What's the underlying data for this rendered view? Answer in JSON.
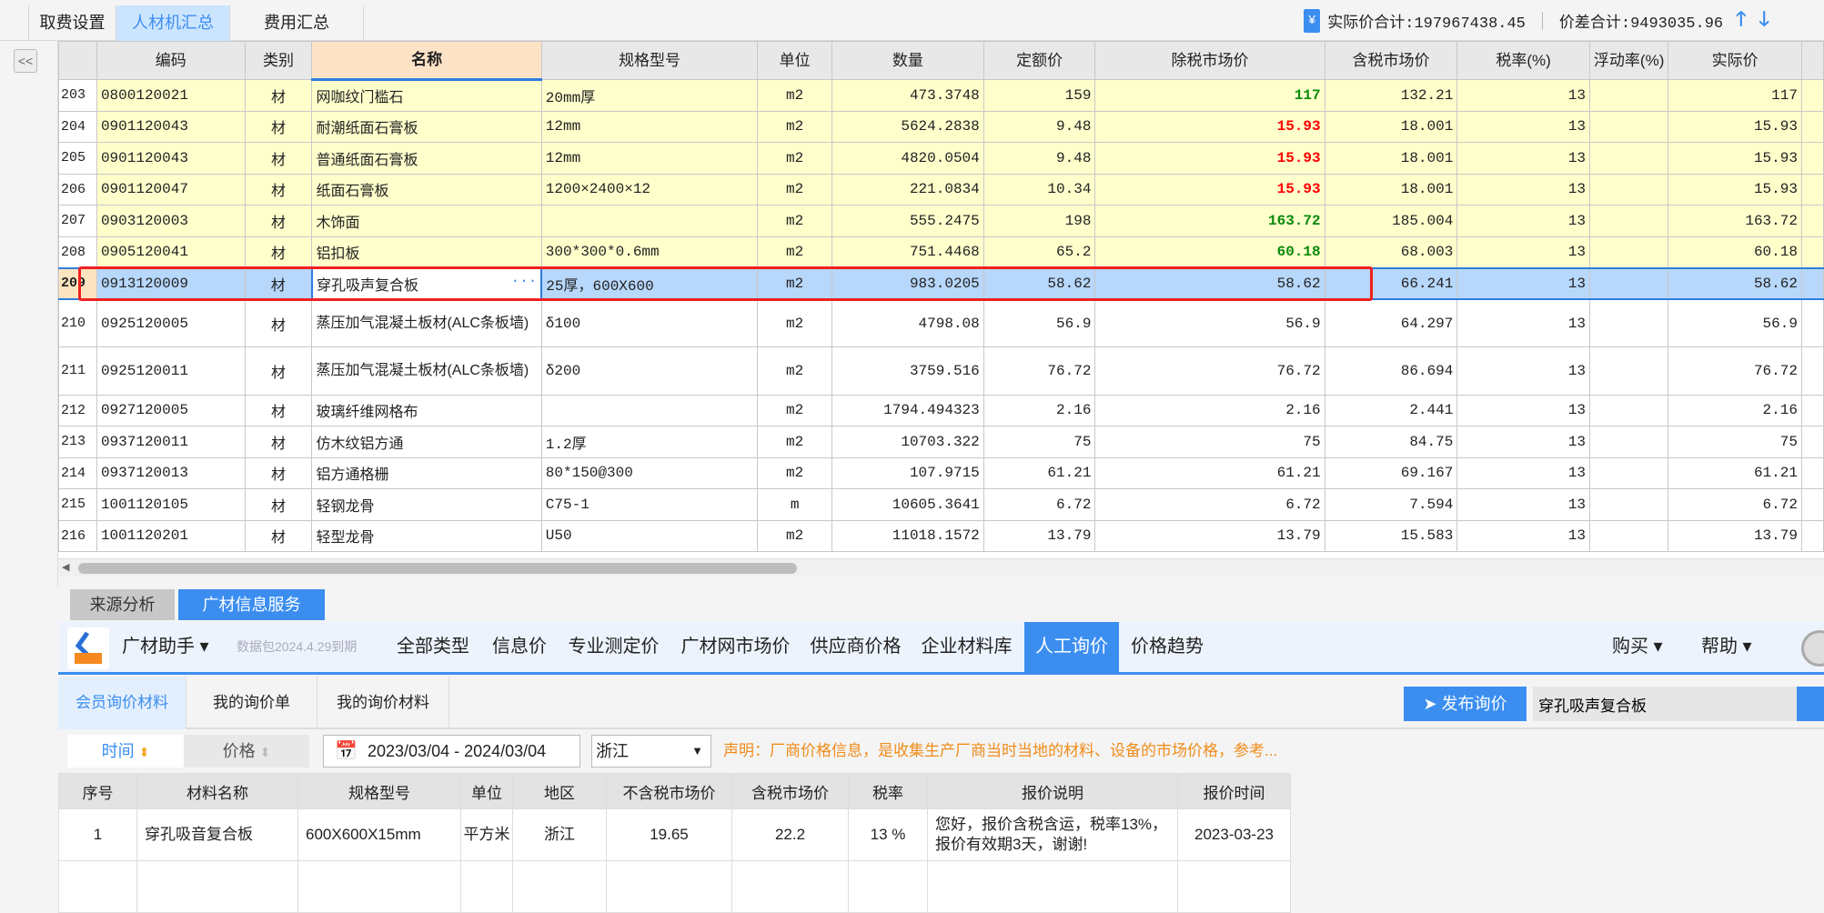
{
  "top_tabs": [
    {
      "label": "取费设置"
    },
    {
      "label": "人材机汇总",
      "active": true
    },
    {
      "label": "费用汇总"
    }
  ],
  "summary": {
    "actual_total": "实际价合计:197967438.45",
    "diff_total": "价差合计:9493035.96",
    "yen_icon": "¥"
  },
  "collapse_label": "<<",
  "grid": {
    "columns": [
      "",
      "编码",
      "类别",
      "名称",
      "规格型号",
      "单位",
      "数量",
      "定额价",
      "除税市场价",
      "含税市场价",
      "税率(%)",
      "浮动率(%)",
      "实际价",
      ""
    ],
    "rows": [
      {
        "no": "203",
        "code": "0800120021",
        "type": "材",
        "name": "网咖纹门槛石",
        "spec": "20mm厚",
        "unit": "m2",
        "qty": "473.3748",
        "quota": "159",
        "market_ex": "117",
        "market_in": "132.21",
        "tax": "13",
        "float": "",
        "actual": "117",
        "style": "yellow",
        "price_color": "green"
      },
      {
        "no": "204",
        "code": "0901120043",
        "type": "材",
        "name": "耐潮纸面石膏板",
        "spec": "12mm",
        "unit": "m2",
        "qty": "5624.2838",
        "quota": "9.48",
        "market_ex": "15.93",
        "market_in": "18.001",
        "tax": "13",
        "float": "",
        "actual": "15.93",
        "style": "yellow",
        "price_color": "red"
      },
      {
        "no": "205",
        "code": "0901120043",
        "type": "材",
        "name": "普通纸面石膏板",
        "spec": "12mm",
        "unit": "m2",
        "qty": "4820.0504",
        "quota": "9.48",
        "market_ex": "15.93",
        "market_in": "18.001",
        "tax": "13",
        "float": "",
        "actual": "15.93",
        "style": "yellow",
        "price_color": "red"
      },
      {
        "no": "206",
        "code": "0901120047",
        "type": "材",
        "name": "纸面石膏板",
        "spec": "1200×2400×12",
        "unit": "m2",
        "qty": "221.0834",
        "quota": "10.34",
        "market_ex": "15.93",
        "market_in": "18.001",
        "tax": "13",
        "float": "",
        "actual": "15.93",
        "style": "yellow",
        "price_color": "red"
      },
      {
        "no": "207",
        "code": "0903120003",
        "type": "材",
        "name": "木饰面",
        "spec": "",
        "unit": "m2",
        "qty": "555.2475",
        "quota": "198",
        "market_ex": "163.72",
        "market_in": "185.004",
        "tax": "13",
        "float": "",
        "actual": "163.72",
        "style": "yellow",
        "price_color": "green"
      },
      {
        "no": "208",
        "code": "0905120041",
        "type": "材",
        "name": "铝扣板",
        "spec": "300*300*0.6mm",
        "unit": "m2",
        "qty": "751.4468",
        "quota": "65.2",
        "market_ex": "60.18",
        "market_in": "68.003",
        "tax": "13",
        "float": "",
        "actual": "60.18",
        "style": "yellow",
        "price_color": "green"
      },
      {
        "no": "209",
        "code": "0913120009",
        "type": "材",
        "name": "穿孔吸声复合板",
        "spec": "25厚，600X600",
        "unit": "m2",
        "qty": "983.0205",
        "quota": "58.62",
        "market_ex": "58.62",
        "market_in": "66.241",
        "tax": "13",
        "float": "",
        "actual": "58.62",
        "style": "selected",
        "price_color": ""
      },
      {
        "no": "210",
        "code": "0925120005",
        "type": "材",
        "name": "蒸压加气混凝土板材(ALC条板墙)",
        "spec": "δ100",
        "unit": "m2",
        "qty": "4798.08",
        "quota": "56.9",
        "market_ex": "56.9",
        "market_in": "64.297",
        "tax": "13",
        "float": "",
        "actual": "56.9",
        "style": "tall",
        "price_color": ""
      },
      {
        "no": "211",
        "code": "0925120011",
        "type": "材",
        "name": "蒸压加气混凝土板材(ALC条板墙)",
        "spec": "δ200",
        "unit": "m2",
        "qty": "3759.516",
        "quota": "76.72",
        "market_ex": "76.72",
        "market_in": "86.694",
        "tax": "13",
        "float": "",
        "actual": "76.72",
        "style": "tall",
        "price_color": ""
      },
      {
        "no": "212",
        "code": "0927120005",
        "type": "材",
        "name": "玻璃纤维网格布",
        "spec": "",
        "unit": "m2",
        "qty": "1794.494323",
        "quota": "2.16",
        "market_ex": "2.16",
        "market_in": "2.441",
        "tax": "13",
        "float": "",
        "actual": "2.16",
        "style": "",
        "price_color": ""
      },
      {
        "no": "213",
        "code": "0937120011",
        "type": "材",
        "name": "仿木纹铝方通",
        "spec": "1.2厚",
        "unit": "m2",
        "qty": "10703.322",
        "quota": "75",
        "market_ex": "75",
        "market_in": "84.75",
        "tax": "13",
        "float": "",
        "actual": "75",
        "style": "",
        "price_color": ""
      },
      {
        "no": "214",
        "code": "0937120013",
        "type": "材",
        "name": "铝方通格栅",
        "spec": "80*150@300",
        "unit": "m2",
        "qty": "107.9715",
        "quota": "61.21",
        "market_ex": "61.21",
        "market_in": "69.167",
        "tax": "13",
        "float": "",
        "actual": "61.21",
        "style": "",
        "price_color": ""
      },
      {
        "no": "215",
        "code": "1001120105",
        "type": "材",
        "name": "轻钢龙骨",
        "spec": "C75-1",
        "unit": "m",
        "qty": "10605.3641",
        "quota": "6.72",
        "market_ex": "6.72",
        "market_in": "7.594",
        "tax": "13",
        "float": "",
        "actual": "6.72",
        "style": "",
        "price_color": ""
      },
      {
        "no": "216",
        "code": "1001120201",
        "type": "材",
        "name": "轻型龙骨",
        "spec": "U50",
        "unit": "m2",
        "qty": "11018.1572",
        "quota": "13.79",
        "market_ex": "13.79",
        "market_in": "15.583",
        "tax": "13",
        "float": "",
        "actual": "13.79",
        "style": "",
        "price_color": ""
      }
    ]
  },
  "bottom_tabs": [
    {
      "label": "来源分析"
    },
    {
      "label": "广材信息服务",
      "active": true
    }
  ],
  "assistant": {
    "title": "广材助手 ▾",
    "data_pack": "数据包2024.4.29到期",
    "nav": [
      {
        "label": "全部类型"
      },
      {
        "label": "信息价"
      },
      {
        "label": "专业测定价"
      },
      {
        "label": "广材网市场价"
      },
      {
        "label": "供应商价格"
      },
      {
        "label": "企业材料库"
      },
      {
        "label": "人工询价",
        "active": true
      },
      {
        "label": "价格趋势"
      }
    ],
    "buy": "购买 ▾",
    "help": "帮助 ▾"
  },
  "subtabs": [
    {
      "label": "会员询价材料",
      "active": true
    },
    {
      "label": "我的询价单"
    },
    {
      "label": "我的询价材料"
    }
  ],
  "publish_label": "发布询价",
  "search_value": "穿孔吸声复合板",
  "filters": {
    "sort_time": "时间",
    "sort_price": "价格",
    "date_range": "2023/03/04 - 2024/03/04",
    "region": "浙江",
    "notice": "声明：厂商价格信息，是收集生产厂商当时当地的材料、设备的市场价格，参考..."
  },
  "quotes": {
    "columns": [
      "序号",
      "材料名称",
      "规格型号",
      "单位",
      "地区",
      "不含税市场价",
      "含税市场价",
      "税率",
      "报价说明",
      "报价时间"
    ],
    "rows": [
      {
        "no": "1",
        "name": "穿孔吸音复合板",
        "spec": "600X600X15mm",
        "unit": "平方米",
        "region": "浙江",
        "price_ex": "19.65",
        "price_in": "22.2",
        "tax": "13 %",
        "note": "您好，报价含税含运，税率13%，报价有效期3天，谢谢!",
        "date": "2023-03-23"
      }
    ]
  },
  "colors": {
    "accent": "#3b8ef0",
    "highlight_box": "#f02020",
    "yellow_row": "#ffffcc",
    "green_price": "#0a8a0a",
    "red_price": "#ff0000",
    "notice": "#f08c1a"
  }
}
